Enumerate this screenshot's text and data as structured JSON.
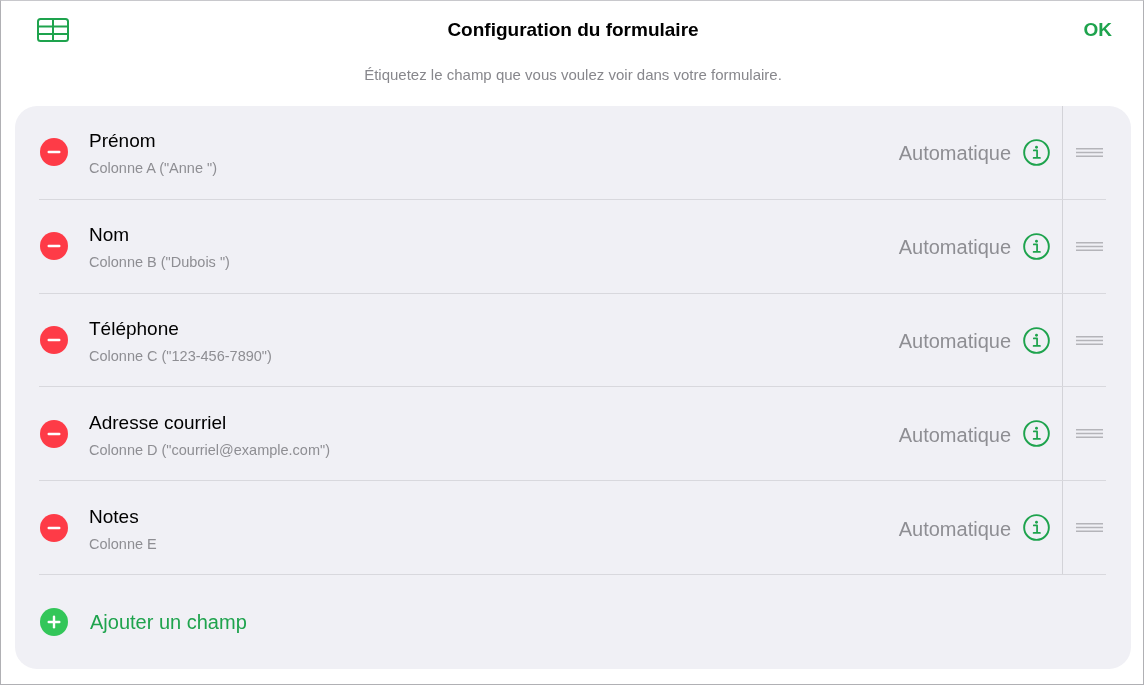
{
  "header": {
    "title": "Configuration du formulaire",
    "done_button": "OK",
    "subtitle": "Étiquetez le champ que vous voulez voir dans votre formulaire."
  },
  "fields": [
    {
      "name": "Prénom",
      "source": "Colonne A (\"Anne \")",
      "type": "Automatique"
    },
    {
      "name": "Nom",
      "source": "Colonne B (\"Dubois \")",
      "type": "Automatique"
    },
    {
      "name": "Téléphone",
      "source": "Colonne C (\"123-456-7890\")",
      "type": "Automatique"
    },
    {
      "name": "Adresse courriel",
      "source": "Colonne D (\"courriel@example.com\")",
      "type": "Automatique"
    },
    {
      "name": "Notes",
      "source": "Colonne E",
      "type": "Automatique"
    }
  ],
  "add_button": "Ajouter un champ"
}
